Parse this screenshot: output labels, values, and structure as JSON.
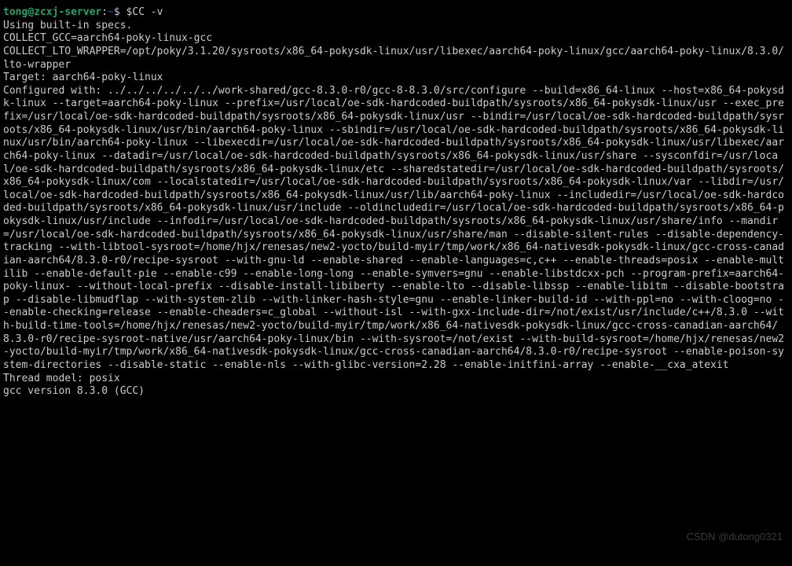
{
  "prompt": {
    "user": "tong",
    "at": "@",
    "host": "zcxj-server",
    "sep1": ":",
    "path": "~",
    "sep2": "$ "
  },
  "command": "$CC -v",
  "output": {
    "line1": "Using built-in specs.",
    "line2": "COLLECT_GCC=aarch64-poky-linux-gcc",
    "line3": "COLLECT_LTO_WRAPPER=/opt/poky/3.1.20/sysroots/x86_64-pokysdk-linux/usr/libexec/aarch64-poky-linux/gcc/aarch64-poky-linux/8.3.0/lto-wrapper",
    "line4": "Target: aarch64-poky-linux",
    "line5": "Configured with: ../../../../../../work-shared/gcc-8.3.0-r0/gcc-8-8.3.0/src/configure --build=x86_64-linux --host=x86_64-pokysdk-linux --target=aarch64-poky-linux --prefix=/usr/local/oe-sdk-hardcoded-buildpath/sysroots/x86_64-pokysdk-linux/usr --exec_prefix=/usr/local/oe-sdk-hardcoded-buildpath/sysroots/x86_64-pokysdk-linux/usr --bindir=/usr/local/oe-sdk-hardcoded-buildpath/sysroots/x86_64-pokysdk-linux/usr/bin/aarch64-poky-linux --sbindir=/usr/local/oe-sdk-hardcoded-buildpath/sysroots/x86_64-pokysdk-linux/usr/bin/aarch64-poky-linux --libexecdir=/usr/local/oe-sdk-hardcoded-buildpath/sysroots/x86_64-pokysdk-linux/usr/libexec/aarch64-poky-linux --datadir=/usr/local/oe-sdk-hardcoded-buildpath/sysroots/x86_64-pokysdk-linux/usr/share --sysconfdir=/usr/local/oe-sdk-hardcoded-buildpath/sysroots/x86_64-pokysdk-linux/etc --sharedstatedir=/usr/local/oe-sdk-hardcoded-buildpath/sysroots/x86_64-pokysdk-linux/com --localstatedir=/usr/local/oe-sdk-hardcoded-buildpath/sysroots/x86_64-pokysdk-linux/var --libdir=/usr/local/oe-sdk-hardcoded-buildpath/sysroots/x86_64-pokysdk-linux/usr/lib/aarch64-poky-linux --includedir=/usr/local/oe-sdk-hardcoded-buildpath/sysroots/x86_64-pokysdk-linux/usr/include --oldincludedir=/usr/local/oe-sdk-hardcoded-buildpath/sysroots/x86_64-pokysdk-linux/usr/include --infodir=/usr/local/oe-sdk-hardcoded-buildpath/sysroots/x86_64-pokysdk-linux/usr/share/info --mandir=/usr/local/oe-sdk-hardcoded-buildpath/sysroots/x86_64-pokysdk-linux/usr/share/man --disable-silent-rules --disable-dependency-tracking --with-libtool-sysroot=/home/hjx/renesas/new2-yocto/build-myir/tmp/work/x86_64-nativesdk-pokysdk-linux/gcc-cross-canadian-aarch64/8.3.0-r0/recipe-sysroot --with-gnu-ld --enable-shared --enable-languages=c,c++ --enable-threads=posix --enable-multilib --enable-default-pie --enable-c99 --enable-long-long --enable-symvers=gnu --enable-libstdcxx-pch --program-prefix=aarch64-poky-linux- --without-local-prefix --disable-install-libiberty --enable-lto --disable-libssp --enable-libitm --disable-bootstrap --disable-libmudflap --with-system-zlib --with-linker-hash-style=gnu --enable-linker-build-id --with-ppl=no --with-cloog=no --enable-checking=release --enable-cheaders=c_global --without-isl --with-gxx-include-dir=/not/exist/usr/include/c++/8.3.0 --with-build-time-tools=/home/hjx/renesas/new2-yocto/build-myir/tmp/work/x86_64-nativesdk-pokysdk-linux/gcc-cross-canadian-aarch64/8.3.0-r0/recipe-sysroot-native/usr/aarch64-poky-linux/bin --with-sysroot=/not/exist --with-build-sysroot=/home/hjx/renesas/new2-yocto/build-myir/tmp/work/x86_64-nativesdk-pokysdk-linux/gcc-cross-canadian-aarch64/8.3.0-r0/recipe-sysroot --enable-poison-system-directories --disable-static --enable-nls --with-glibc-version=2.28 --enable-initfini-array --enable-__cxa_atexit",
    "line6": "Thread model: posix",
    "line7": "gcc version 8.3.0 (GCC)"
  },
  "watermark": "CSDN @dutong0321"
}
